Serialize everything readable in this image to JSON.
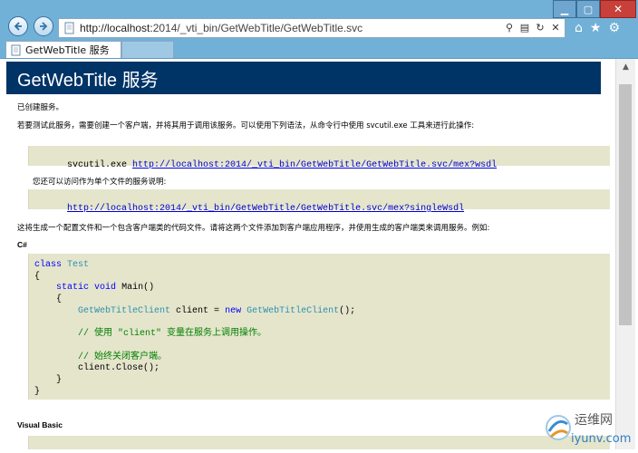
{
  "browser": {
    "url_host": "http://localhost:",
    "url_rest": "2014/_vti_bin/GetWebTitle/GetWebTitle.svc",
    "tab_title": "GetWebTitle 服务",
    "icons": [
      "back-icon",
      "forward-icon",
      "search-icon",
      "compatibility-icon",
      "refresh-icon",
      "stop-icon",
      "home-icon",
      "favorites-star-icon",
      "settings-gear-icon"
    ]
  },
  "page": {
    "title": "GetWebTitle 服务",
    "p_created": "已创建服务。",
    "p_test": "若要测试此服务，需要创建一个客户端，并将其用于调用该服务。可以使用下列语法，从命令行中使用 svcutil.exe 工具来进行此操作:",
    "svcutil_cmd": "svcutil.exe ",
    "svcutil_link": "http://localhost:2014/_vti_bin/GetWebTitle/GetWebTitle.svc/mex?wsdl",
    "p_single": "您还可以访问作为单个文件的服务说明:",
    "single_link": "http://localhost:2014/_vti_bin/GetWebTitle/GetWebTitle.svc/mex?singleWsdl",
    "p_generate": "这将生成一个配置文件和一个包含客户端类的代码文件。请将这两个文件添加到客户端应用程序，并使用生成的客户端类来调用服务。例如:",
    "csharp_heading": "C#",
    "vb_heading": "Visual Basic",
    "code": {
      "l1_kw": "class",
      "l1_type": "Test",
      "brace_open": "{",
      "brace_close": "}",
      "l3_kw1": "static",
      "l3_kw2": "void",
      "l3_rest": "Main()",
      "l5_type": "GetWebTitleClient",
      "l5_mid": " client = ",
      "l5_kw": "new",
      "l5_type2": "GetWebTitleClient",
      "l5_end": "();",
      "l7_comment": "// 使用 \"client\" 变量在服务上调用操作。",
      "l9_comment": "// 始终关闭客户端。",
      "l10": "client.Close();"
    }
  },
  "watermark": {
    "brand": "运维网",
    "domain": "iyunv.com"
  },
  "colors": {
    "header_bg": "#003366",
    "code_bg": "#e5e5cc",
    "chrome_bg": "#71b1d8"
  }
}
